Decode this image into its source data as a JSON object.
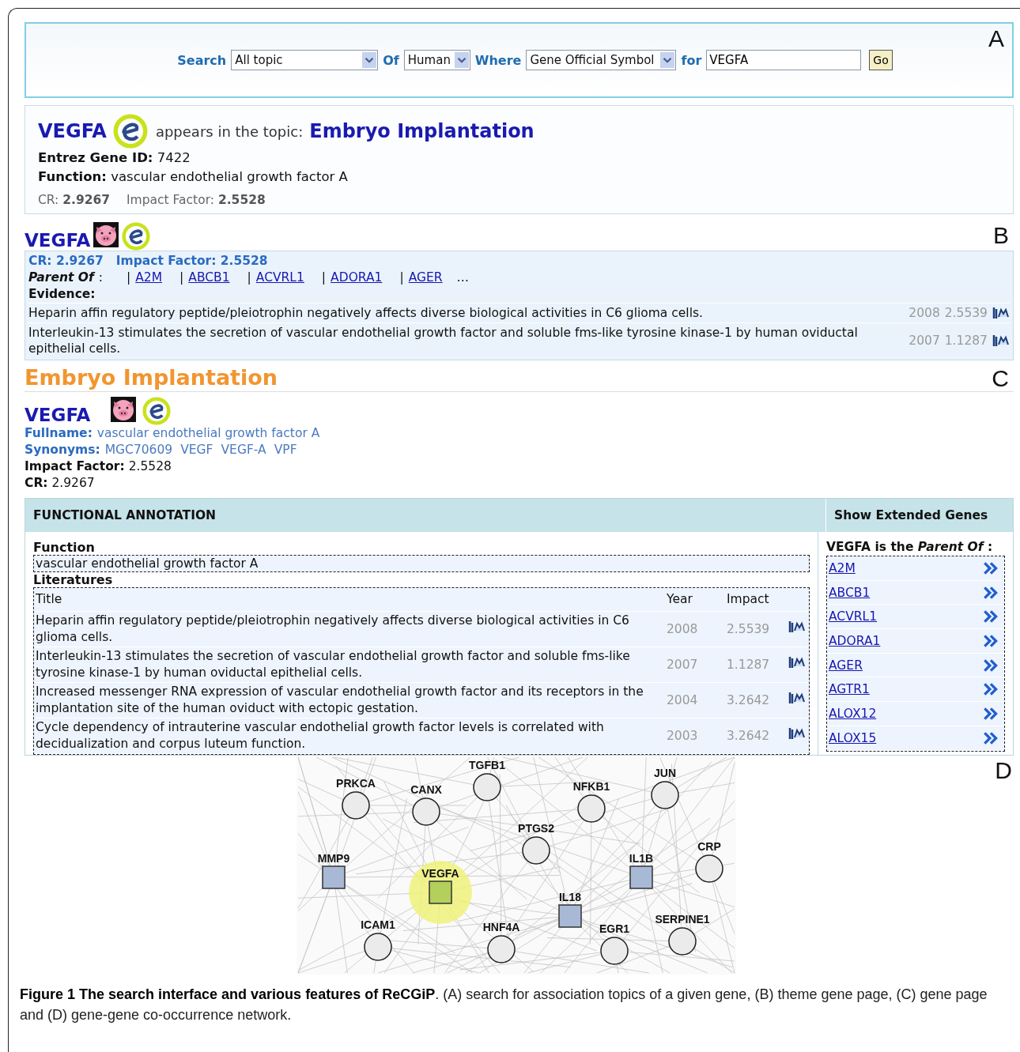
{
  "search_panel": {
    "panel_letter": "A",
    "search_label": "Search",
    "topic_select": "All topic",
    "of_label": "Of",
    "species_select": "Human",
    "where_label": "Where",
    "field_select": "Gene Official Symbol",
    "for_label": "for",
    "query": "VEGFA",
    "go_button": "Go"
  },
  "topic_result": {
    "gene": "VEGFA",
    "phrase": "appears in the topic:",
    "topic": "Embryo Implantation",
    "entrez_label": "Entrez Gene ID:",
    "entrez_id": "7422",
    "function_label": "Function:",
    "function": "vascular endothelial growth factor A",
    "cr_label": "CR:",
    "cr": "2.9267",
    "impact_label": "Impact Factor:",
    "impact": "2.5528"
  },
  "theme_gene": {
    "panel_letter": "B",
    "gene": "VEGFA",
    "cr_line": "CR: 2.9267",
    "impact_line": "Impact Factor: 2.5528",
    "parent_label": "Parent Of",
    "parent_colon": ":",
    "separator": "|",
    "parents": [
      "A2M",
      "ABCB1",
      "ACVRL1",
      "ADORA1",
      "AGER"
    ],
    "more": "…",
    "evidence_label": "Evidence:",
    "evidence": [
      {
        "title": "Heparin affin regulatory peptide/pleiotrophin negatively affects diverse biological activities in C6 glioma cells.",
        "year": "2008",
        "impact": "2.5539"
      },
      {
        "title": "Interleukin-13 stimulates the secretion of vascular endothelial growth factor and soluble fms-like tyrosine kinase-1 by human oviductal epithelial cells.",
        "year": "2007",
        "impact": "1.1287"
      }
    ]
  },
  "gene_page": {
    "panel_letter": "C",
    "topic": "Embryo Implantation",
    "gene": "VEGFA",
    "fullname_label": "Fullname:",
    "fullname": "vascular endothelial growth factor A",
    "synonyms_label": "Synonyms:",
    "synonyms": [
      "MGC70609",
      "VEGF",
      "VEGF-A",
      "VPF"
    ],
    "impact_label": "Impact Factor:",
    "impact": "2.5528",
    "cr_label": "CR:",
    "cr": "2.9267",
    "annotation": {
      "header": "FUNCTIONAL ANNOTATION",
      "function_label": "Function",
      "function": "vascular endothelial growth factor A",
      "literatures_label": "Literatures",
      "columns": [
        "Title",
        "Year",
        "Impact"
      ],
      "rows": [
        {
          "title": "Heparin affin regulatory peptide/pleiotrophin negatively affects diverse biological activities in C6 glioma cells.",
          "year": "2008",
          "impact": "2.5539"
        },
        {
          "title": "Interleukin-13 stimulates the secretion of vascular endothelial growth factor and soluble fms-like tyrosine kinase-1 by human oviductal epithelial cells.",
          "year": "2007",
          "impact": "1.1287"
        },
        {
          "title": "Increased messenger RNA expression of vascular endothelial growth factor and its receptors in the implantation site of the human oviduct with ectopic gestation.",
          "year": "2004",
          "impact": "3.2642"
        },
        {
          "title": "Cycle dependency of intrauterine vascular endothelial growth factor levels is correlated with decidualization and corpus luteum function.",
          "year": "2003",
          "impact": "3.2642"
        }
      ]
    },
    "extended": {
      "header": "Show Extended Genes",
      "intro": "VEGFA is the *Parent Of* :",
      "genes": [
        "A2M",
        "ABCB1",
        "ACVRL1",
        "ADORA1",
        "AGER",
        "AGTR1",
        "ALOX12",
        "ALOX15"
      ]
    }
  },
  "network": {
    "panel_letter": "D",
    "nodes": [
      {
        "label": "PRKCA",
        "kind": "circle",
        "highlighted": false
      },
      {
        "label": "CANX",
        "kind": "circle",
        "highlighted": false
      },
      {
        "label": "TGFB1",
        "kind": "circle",
        "highlighted": false
      },
      {
        "label": "NFKB1",
        "kind": "circle",
        "highlighted": false
      },
      {
        "label": "JUN",
        "kind": "circle",
        "highlighted": false
      },
      {
        "label": "PTGS2",
        "kind": "circle",
        "highlighted": false
      },
      {
        "label": "CRP",
        "kind": "circle",
        "highlighted": false
      },
      {
        "label": "MMP9",
        "kind": "square",
        "highlighted": false
      },
      {
        "label": "VEGFA",
        "kind": "square",
        "highlighted": true
      },
      {
        "label": "IL1B",
        "kind": "square",
        "highlighted": false
      },
      {
        "label": "IL18",
        "kind": "square",
        "highlighted": false
      },
      {
        "label": "ICAM1",
        "kind": "circle",
        "highlighted": false
      },
      {
        "label": "HNF4A",
        "kind": "circle",
        "highlighted": false
      },
      {
        "label": "EGR1",
        "kind": "circle",
        "highlighted": false
      },
      {
        "label": "SERPINE1",
        "kind": "circle",
        "highlighted": false
      }
    ]
  },
  "caption": "**Figure 1 The search interface and various features of ReCGiP**. (A) search for association topics of a given gene, (B) theme gene page, (C) gene page and (D) gene-gene co-occurrence network."
}
